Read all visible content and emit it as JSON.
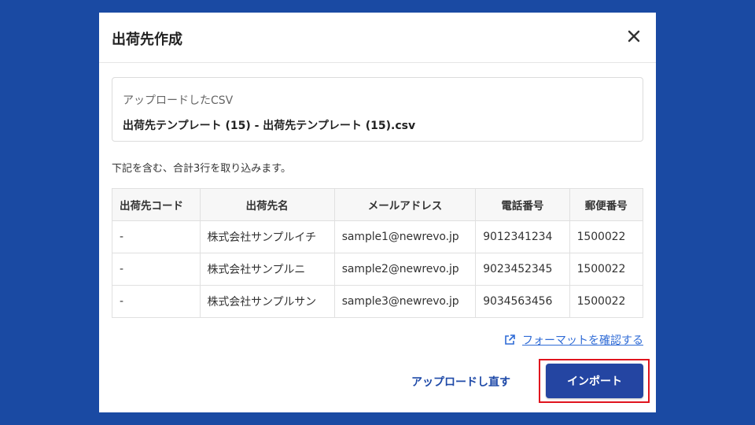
{
  "dialog": {
    "title": "出荷先作成",
    "close_icon": "close-icon"
  },
  "upload": {
    "label": "アップロードしたCSV",
    "file_name": "出荷先テンプレート (15) - 出荷先テンプレート (15).csv"
  },
  "summary": "下記を含む、合計3行を取り込みます。",
  "table": {
    "headers": [
      "出荷先コード",
      "出荷先名",
      "メールアドレス",
      "電話番号",
      "郵便番号"
    ],
    "rows": [
      [
        "-",
        "株式会社サンプルイチ",
        "sample1@newrevo.jp",
        "9012341234",
        "1500022"
      ],
      [
        "-",
        "株式会社サンプルニ",
        "sample2@newrevo.jp",
        "9023452345",
        "1500022"
      ],
      [
        "-",
        "株式会社サンプルサン",
        "sample3@newrevo.jp",
        "9034563456",
        "1500022"
      ]
    ]
  },
  "format_link": {
    "label": "フォーマットを確認する",
    "icon": "external-link-icon"
  },
  "actions": {
    "reupload_label": "アップロードし直す",
    "import_label": "インポート"
  },
  "colors": {
    "background": "#1a4aa3",
    "primary_button": "#2445a2",
    "link": "#2f6bd6",
    "highlight": "#e0141e"
  }
}
